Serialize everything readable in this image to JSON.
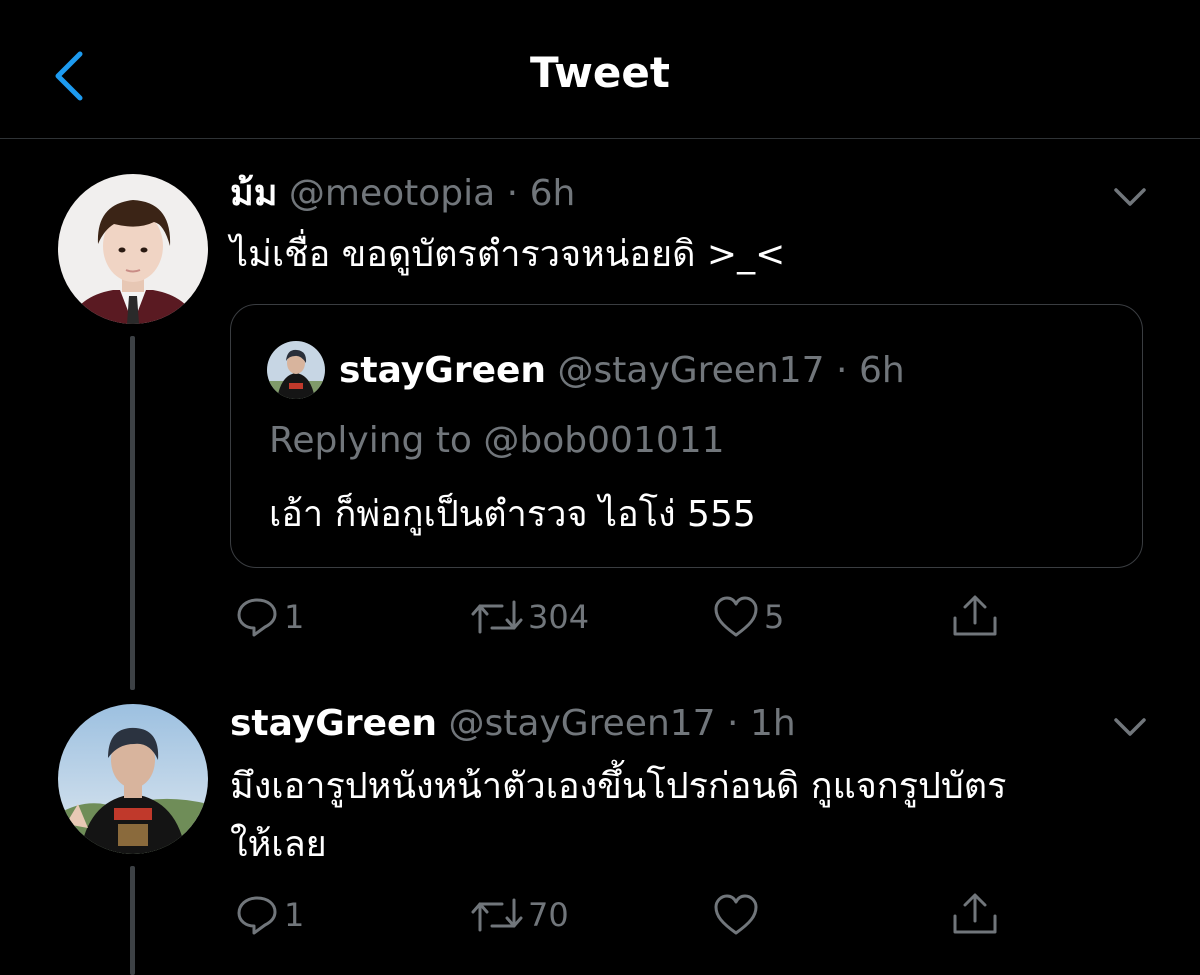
{
  "header": {
    "title": "Tweet"
  },
  "tweets": [
    {
      "name": "ม้ม",
      "handle": "@meotopia",
      "sep": "·",
      "time": "6h",
      "text": "ไม่เชื่อ ขอดูบัตรตำรวจหน่อยดิ >_<",
      "quote": {
        "name": "stayGreen",
        "handle": "@stayGreen17",
        "sep": "·",
        "time": "6h",
        "reply": "Replying to @bob001011",
        "text": "เอ้า ก็พ่อกูเป็นตำรวจ ไอโง่ 555"
      },
      "actions": {
        "replies": "1",
        "retweets": "304",
        "likes": "5"
      }
    },
    {
      "name": "stayGreen",
      "handle": "@stayGreen17",
      "sep": "·",
      "time": "1h",
      "text_line1": "มึงเอารูปหนังหน้าตัวเองขึ้นโปรก่อนดิ กูแจกรูปบัตร",
      "text_line2": "ให้เลย",
      "actions": {
        "replies": "1",
        "retweets": "70",
        "likes": ""
      }
    }
  ],
  "colors": {
    "background": "#000000",
    "accent": "#1d9bf0",
    "muted": "#71767b",
    "divider": "#2f3336"
  },
  "icons": [
    "back-arrow-icon",
    "chevron-down-icon",
    "reply-icon",
    "retweet-icon",
    "like-icon",
    "share-icon"
  ]
}
